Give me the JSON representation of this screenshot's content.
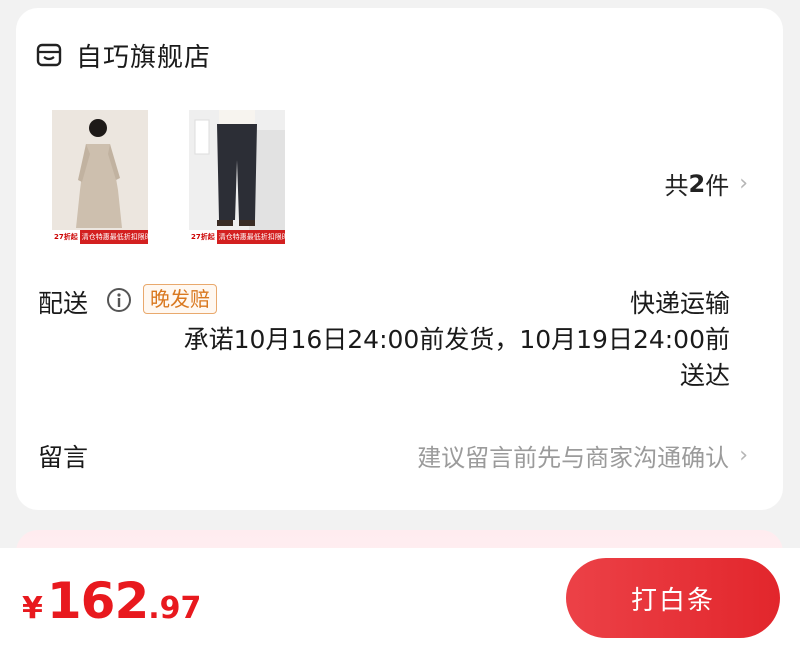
{
  "store": {
    "name": "自巧旗舰店",
    "icon": "shop-icon"
  },
  "items": {
    "thumbnails": [
      {
        "icon": "product-dress-thumbnail",
        "tag_price": "27折起",
        "tag_text": "清仓特惠最低折扣限时抢购"
      },
      {
        "icon": "product-jeans-thumbnail",
        "tag_price": "27折起",
        "tag_text": "清仓特惠最低折扣限时抢购"
      }
    ],
    "count_prefix": "共",
    "count": "2",
    "count_suffix": "件"
  },
  "shipping": {
    "label": "配送",
    "badge": "晚发赔",
    "method": "快递运输",
    "promise": "承诺10月16日24:00前发货，10月19日24:00前送达"
  },
  "message": {
    "label": "留言",
    "placeholder": "建议留言前先与商家沟通确认"
  },
  "footer": {
    "currency": "¥",
    "price_int": "162",
    "price_dec": ".97",
    "pay_button": "打白条"
  },
  "colors": {
    "accent": "#e8191e",
    "badge": "#d9781f"
  }
}
